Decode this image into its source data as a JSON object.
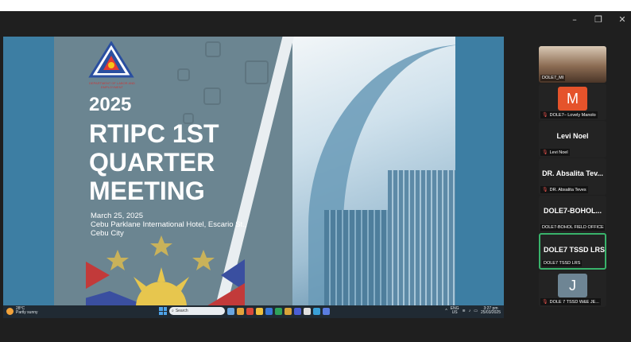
{
  "window_controls": {
    "minimize": "–",
    "restore": "❐",
    "close": "✕"
  },
  "slide": {
    "logo_text": "DEPARTMENT OF LABOR AND EMPLOYMENT",
    "year": "2025",
    "title": "RTIPC 1ST QUARTER MEETING",
    "date": "March 25, 2025",
    "venue": "Cebu Parklane International Hotel, Escario St., Cebu City"
  },
  "taskbar": {
    "weather_temp": "28°C",
    "weather_desc": "Partly sunny",
    "search_placeholder": "Search",
    "lang_top": "ENG",
    "lang_bottom": "US",
    "time": "3:27 pm",
    "date": "25/03/2025"
  },
  "participants": [
    {
      "name": "DOLE7_MI",
      "type": "video",
      "muted": false
    },
    {
      "name": "DOLE7– Lovely Manolo",
      "type": "avatar",
      "initial": "M",
      "color": "#e5532b",
      "muted": true
    },
    {
      "name": "Levi Noel",
      "type": "text",
      "display": "Levi Noel",
      "muted": true
    },
    {
      "name": "DR. Absalita Teves",
      "type": "text",
      "display": "DR. Absalita Tev...",
      "muted": true
    },
    {
      "name": "DOLE7-BOHOL FIELD OFFICE",
      "type": "text",
      "display": "DOLE7-BOHOL...",
      "muted": false
    },
    {
      "name": "DOLE7 TSSD LRS",
      "type": "text",
      "display": "DOLE7 TSSD LRS",
      "muted": false,
      "active": true
    },
    {
      "name": "DOLE 7 TSSD W&E JE...",
      "type": "avatar",
      "initial": "J",
      "color": "#6e8594",
      "muted": true
    }
  ],
  "colors": {
    "share_bg": "#3d7ea3",
    "slide_bg": "#6b8591",
    "active_border": "#39b36b",
    "mute_red": "#e0504a"
  },
  "icons": [
    "minimize-icon",
    "restore-icon",
    "close-icon",
    "windows-start-icon",
    "search-icon",
    "mic-off-icon",
    "wifi-icon",
    "speaker-icon",
    "battery-icon"
  ]
}
